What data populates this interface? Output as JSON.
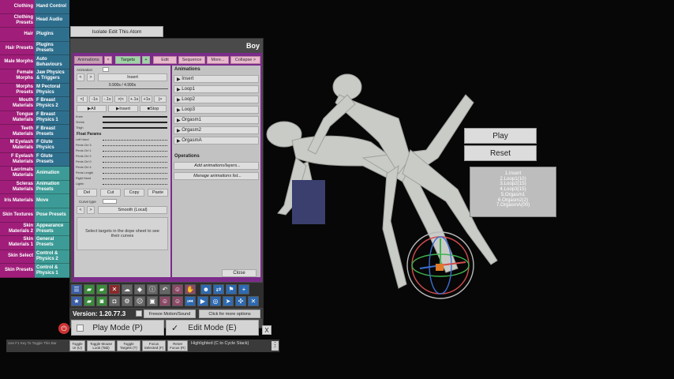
{
  "menu": {
    "rows": [
      {
        "left": "Clothing",
        "right": "Hand Control"
      },
      {
        "left": "Clothing Presets",
        "right": "Head Audio"
      },
      {
        "left": "Hair",
        "right": "Plugins"
      },
      {
        "left": "Hair Presets",
        "right": "Plugins Presets"
      },
      {
        "left": "Male Morphs",
        "right": "Auto Behaviours"
      },
      {
        "left": "Female Morphs",
        "right": "Jaw Physics & Triggers"
      },
      {
        "left": "Morphs Presets",
        "right": "M Pectoral Physics"
      },
      {
        "left": "Mouth Materials",
        "right": "F Breast Physics 2"
      },
      {
        "left": "Tongue Materials",
        "right": "F Breast Physics 1"
      },
      {
        "left": "Teeth Materials",
        "right": "F Breast Presets"
      },
      {
        "left": "M Eyelash Materials",
        "right": "F Glute Physics"
      },
      {
        "left": "F Eyelash Materials",
        "right": "F Glute Presets"
      },
      {
        "left": "Lacrimals Materials",
        "right": "Animation"
      },
      {
        "left": "Scleras Materials",
        "right": "Animation Presets"
      },
      {
        "left": "Iris Materials",
        "right": "Move"
      },
      {
        "left": "Skin Textures",
        "right": "Pose Presets"
      },
      {
        "left": "Skin Materials 2",
        "right": "Appearance Presets"
      },
      {
        "left": "Skin Materials 1",
        "right": "General Presets"
      },
      {
        "left": "Skin Select",
        "right": "Control & Physics 2"
      },
      {
        "left": "Skin Presets",
        "right": "Control & Physics 1"
      }
    ]
  },
  "isolate_label": "Isolate Edit This Atom",
  "panel": {
    "title": "Boy",
    "tabs": {
      "animations": "Animations",
      "x": "×",
      "targets": "Targets",
      "plus": "+",
      "edit": "Edit",
      "sequence": "Sequence",
      "more": "More...",
      "collapse": "Collapse >"
    },
    "animation_label": "Animation",
    "nav_prev": "<",
    "nav_next": ">",
    "insert_label": "Insert",
    "time_readout": "0.900s / 4.990s",
    "transport": [
      "<|",
      "-1s",
      "-.1s",
      ">|<",
      "+.1s",
      "+1s",
      "|>"
    ],
    "all_label": "All",
    "insert2_label": "Insert",
    "stop_label": "Stop",
    "dope_rows": [
      "Knee",
      "Shrink",
      "Thigh"
    ],
    "float_params_title": "Float Params",
    "float_rows": [
      "Left Hand",
      "Penis Ctrl 3",
      "Penis Ctrl 1",
      "Penis Ctrl 2",
      "Penis Ctrl 0",
      "Penis Ctrl 4",
      "Penis Length",
      "Right Hand",
      "Lightn"
    ],
    "edit_buttons": [
      "Del",
      "Cut",
      "Copy",
      "Paste"
    ],
    "curve_type_label": "Curve type",
    "smooth_label": "Smooth (Local)",
    "hint": "Select targets in the dope sheet to see their curves",
    "animations_header": "Animations",
    "animation_list": [
      "Insert",
      "Loop1",
      "Loop2",
      "Loop3",
      "Orgasm1",
      "Orgasm2",
      "OrgasmA"
    ],
    "operations_header": "Operations",
    "ops": [
      "Add animations/layers...",
      "Manage animations list..."
    ],
    "close_label": "Close"
  },
  "version": "Version: 1.20.77.3",
  "freeze_label": "Freeze Motion/Sound",
  "more_options": "Click for more options",
  "play_mode": "Play Mode (P)",
  "edit_mode": "Edit Mode (E)",
  "close_x": "X",
  "bottom_bar": {
    "left_hint": "Use F1 Key To Toggle This Bar",
    "buttons": [
      "Toggle UI (U)",
      "Toggle Mouse Look (Tab)",
      "Toggle Targets (T)",
      "Focus Selected (F)",
      "Reset Focus (R)"
    ],
    "status": "Highlighted (C to Cycle Stack)",
    "menu": "⋮"
  },
  "world": {
    "play": "Play",
    "reset": "Reset",
    "sequence": [
      "1.Insert",
      "2.Loop1(10)",
      "3.Loop2(15)",
      "4.Loop3(15)",
      "5.Orgasm1",
      "6.Orgasm2(2)",
      "7.OrgasmA(00)"
    ]
  },
  "colors": {
    "menu_left": "#a01e7a",
    "menu_right": "#2f6f8e",
    "menu_selected": "#3c9b96",
    "panel_border": "#7b2b8a"
  }
}
